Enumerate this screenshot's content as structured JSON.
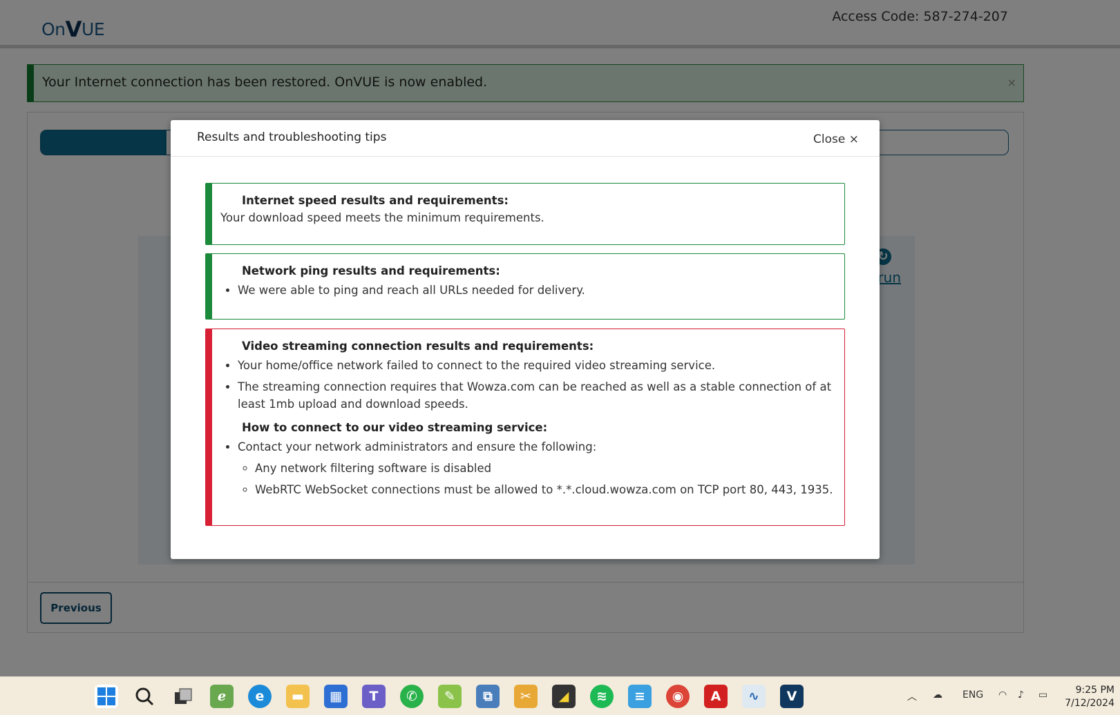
{
  "header": {
    "logo_text": "OnVUE",
    "access_code": "Access Code: 587-274-207"
  },
  "alert": {
    "message": "Your Internet connection has been restored. OnVUE is now enabled.",
    "close_label": "×"
  },
  "main": {
    "progress_percent": 13,
    "rerun_label": "run",
    "previous_button": "Previous"
  },
  "modal": {
    "title": "Results and troubleshooting tips",
    "close_label": "Close ×",
    "results": [
      {
        "status": "pass",
        "heading": "Internet speed results and requirements:",
        "text": "Your download speed meets the minimum requirements."
      },
      {
        "status": "pass",
        "heading": "Network ping results and requirements:",
        "bullets": [
          "We were able to ping and reach all URLs needed for delivery."
        ]
      },
      {
        "status": "fail",
        "heading": "Video streaming connection results and requirements:",
        "bullets": [
          "Your home/office network failed to connect to the required video streaming service.",
          "The streaming connection requires that Wowza.com can be reached as well as a stable connection of at least 1mb upload and download speeds."
        ],
        "heading2": "How to connect to our video streaming service:",
        "bullets2": [
          "Contact your network administrators and ensure the following:"
        ],
        "sub_bullets": [
          "Any network filtering software is disabled",
          "WebRTC WebSocket connections must be allowed to *.*.cloud.wowza.com on TCP port 80, 443, 1935."
        ]
      }
    ]
  },
  "colors": {
    "pass": "#1b8a3a",
    "fail": "#d71f35",
    "primary": "#0a6a8c"
  },
  "taskbar": {
    "apps": [
      "windows-start-icon",
      "search-icon",
      "task-view-icon",
      "edraw-icon",
      "edge-icon",
      "file-explorer-icon",
      "store-icon",
      "teams-icon",
      "whatsapp-icon",
      "paint-icon",
      "remote-desktop-icon",
      "tools-icon",
      "sticky-notes-icon",
      "spotify-icon",
      "notepad-icon",
      "chrome-icon",
      "acrobat-icon",
      "resource-monitor-icon",
      "onvue-icon"
    ],
    "tray": {
      "language": "ENG"
    },
    "clock": {
      "time": "9:25 PM",
      "date": "7/12/2024"
    }
  }
}
